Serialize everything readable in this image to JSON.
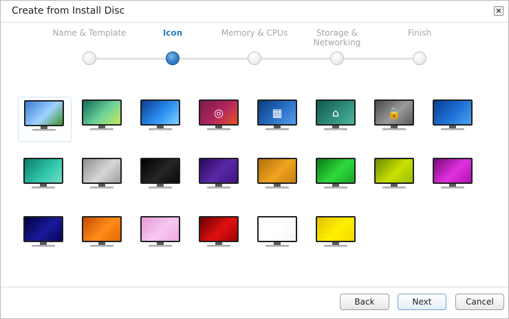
{
  "window": {
    "title": "Create from Install Disc",
    "close_glyph": "×"
  },
  "steps": [
    {
      "label": "Name & Template",
      "active": false
    },
    {
      "label": "Icon",
      "active": true
    },
    {
      "label": "Memory & CPUs",
      "active": false
    },
    {
      "label": "Storage & Networking",
      "active": false
    },
    {
      "label": "Finish",
      "active": false
    }
  ],
  "icons": [
    {
      "name": "landscape-screen-icon",
      "colors": [
        "#3a7bd5",
        "#9fd3ff",
        "#3c8f2a"
      ],
      "selected": true
    },
    {
      "name": "aurora-screen-icon",
      "colors": [
        "#0f6b5a",
        "#6fd39a",
        "#c7e85a"
      ]
    },
    {
      "name": "blue-swirl-screen-icon",
      "colors": [
        "#0a3d91",
        "#2b8ff0",
        "#7fd2ff"
      ]
    },
    {
      "name": "ubuntu-screen-icon",
      "colors": [
        "#7a1a4a",
        "#b2275f",
        "#e95420"
      ],
      "glyph": "◎"
    },
    {
      "name": "building-screen-icon",
      "colors": [
        "#0b3b7a",
        "#2a6fc9",
        "#5aa0e8"
      ],
      "glyph": "▦"
    },
    {
      "name": "home-screen-icon",
      "colors": [
        "#0f5a4f",
        "#2e8c7a",
        "#4fb59d"
      ],
      "glyph": "⌂"
    },
    {
      "name": "lock-screen-icon",
      "colors": [
        "#4a4a4a",
        "#9a9a9a",
        "#5a5a5a"
      ],
      "glyph": "🔒"
    },
    {
      "name": "blue-screen-icon",
      "colors": [
        "#0a3d91",
        "#1e73d8",
        "#4fa3ee"
      ]
    },
    {
      "name": "teal-screen-icon",
      "colors": [
        "#0e7c6b",
        "#2ec4a8",
        "#6fe0c8"
      ]
    },
    {
      "name": "silver-screen-icon",
      "colors": [
        "#8d8d8d",
        "#d6d6d6",
        "#9e9e9e"
      ]
    },
    {
      "name": "black-screen-icon",
      "colors": [
        "#000000",
        "#262626",
        "#080808"
      ]
    },
    {
      "name": "purple-screen-icon",
      "colors": [
        "#2a0a5e",
        "#5a28a8",
        "#3b147b"
      ]
    },
    {
      "name": "orange-gold-screen-icon",
      "colors": [
        "#b06e0a",
        "#f0a320",
        "#c77f10"
      ]
    },
    {
      "name": "green-screen-icon",
      "colors": [
        "#0a7a1a",
        "#2fd93a",
        "#18a82a"
      ]
    },
    {
      "name": "lime-screen-icon",
      "colors": [
        "#6a8a00",
        "#c8e000",
        "#9bbf00"
      ]
    },
    {
      "name": "magenta-screen-icon",
      "colors": [
        "#7a0a7a",
        "#e030e0",
        "#b015b0"
      ]
    },
    {
      "name": "navy-screen-icon",
      "colors": [
        "#00003a",
        "#1a1a9a",
        "#05055e"
      ]
    },
    {
      "name": "orange-screen-icon",
      "colors": [
        "#c44a00",
        "#ff8c1a",
        "#e06a00"
      ]
    },
    {
      "name": "pink-screen-icon",
      "colors": [
        "#e59ad8",
        "#f8c7f0",
        "#eaa6df"
      ]
    },
    {
      "name": "red-screen-icon",
      "colors": [
        "#6a0000",
        "#e01010",
        "#a00000"
      ]
    },
    {
      "name": "white-screen-icon",
      "colors": [
        "#ffffff",
        "#ffffff",
        "#f4f4f4"
      ]
    },
    {
      "name": "yellow-screen-icon",
      "colors": [
        "#e0c000",
        "#fff000",
        "#f0d800"
      ]
    }
  ],
  "buttons": {
    "back": "Back",
    "next": "Next",
    "cancel": "Cancel"
  }
}
